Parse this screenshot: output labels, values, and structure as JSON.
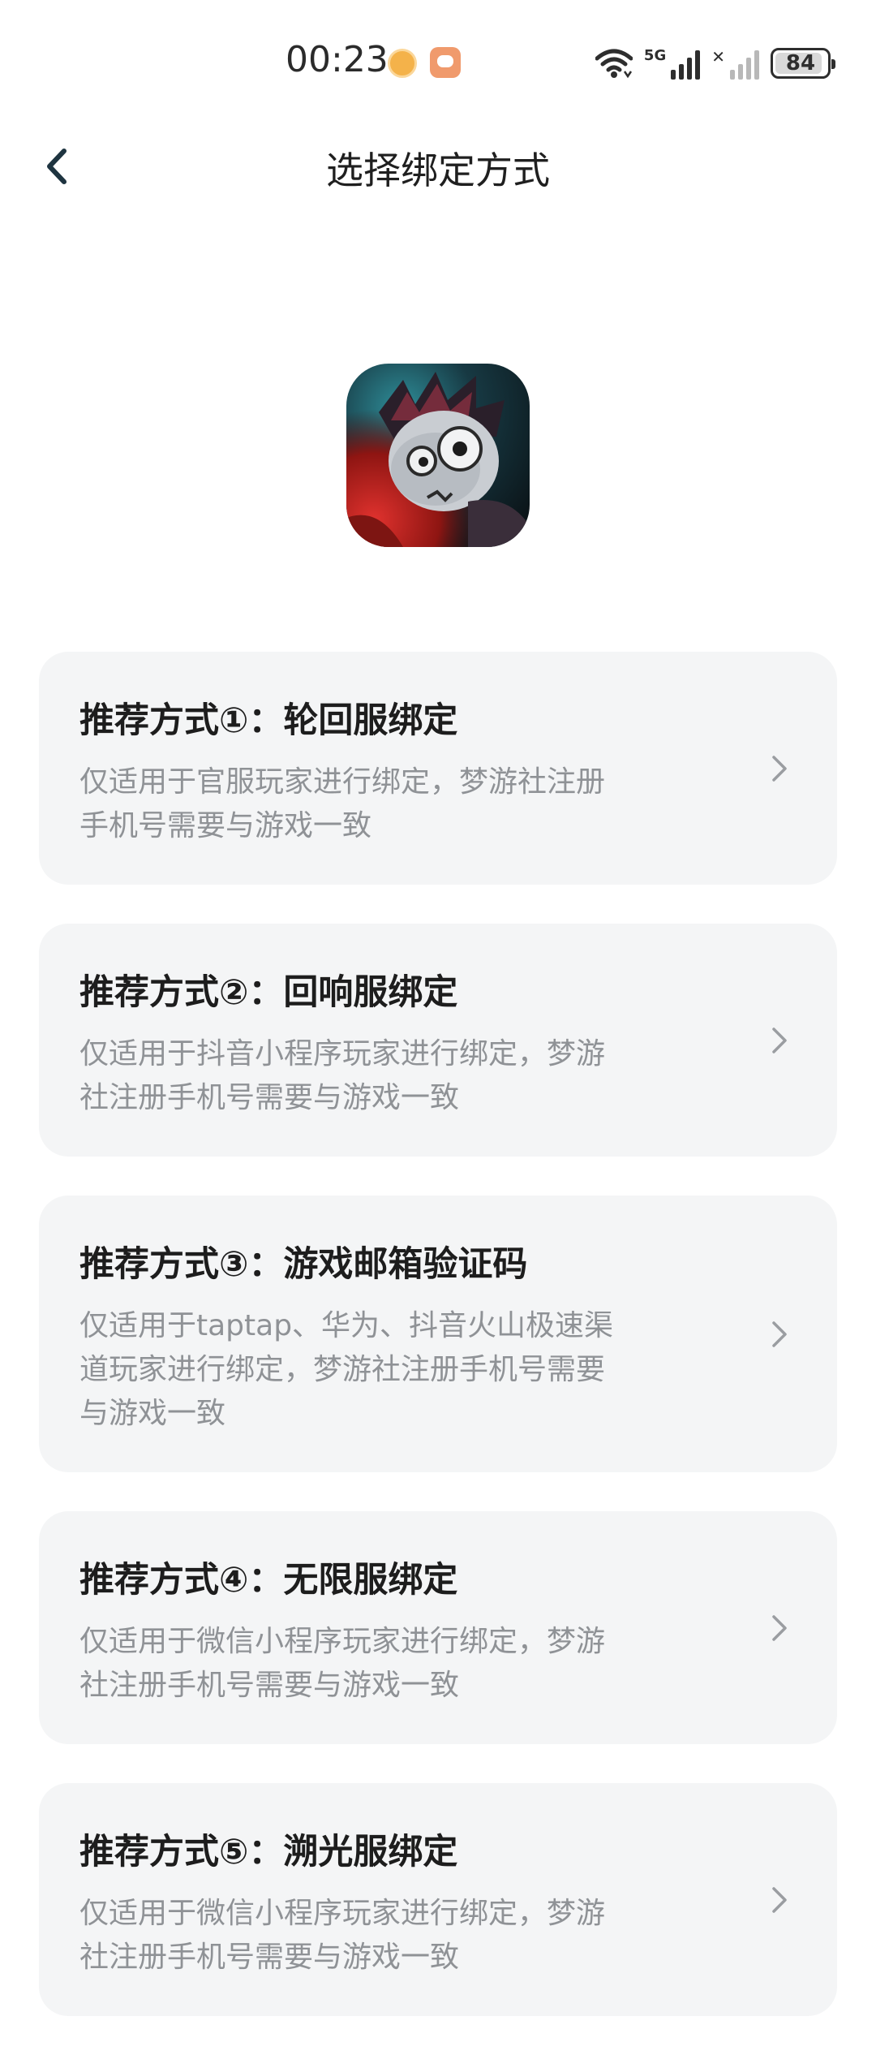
{
  "status_bar": {
    "time": "00:23",
    "network": "5G",
    "battery_level": "84",
    "battery_fraction": 0.84
  },
  "header": {
    "title": "选择绑定方式"
  },
  "options": [
    {
      "title": "推荐方式①：轮回服绑定",
      "desc_lines": [
        "仅适用于官服玩家进行绑定，梦游社注册",
        "手机号需要与游戏一致"
      ]
    },
    {
      "title": "推荐方式②：回响服绑定",
      "desc_lines": [
        "仅适用于抖音小程序玩家进行绑定，梦游",
        "社注册手机号需要与游戏一致"
      ]
    },
    {
      "title": "推荐方式③：游戏邮箱验证码",
      "desc_lines": [
        "仅适用于taptap、华为、抖音火山极速渠",
        "道玩家进行绑定，梦游社注册手机号需要",
        "与游戏一致"
      ]
    },
    {
      "title": "推荐方式④：无限服绑定",
      "desc_lines": [
        "仅适用于微信小程序玩家进行绑定，梦游",
        "社注册手机号需要与游戏一致"
      ]
    },
    {
      "title": "推荐方式⑤：溯光服绑定",
      "desc_lines": [
        "仅适用于微信小程序玩家进行绑定，梦游",
        "社注册手机号需要与游戏一致"
      ]
    }
  ],
  "colors": {
    "card_background": "#f4f5f6",
    "title_text": "#1d1d1d",
    "desc_text": "#8f9296",
    "back_icon": "#1e3440"
  },
  "icons": {
    "back": "chevron-left-icon",
    "row": "chevron-right-icon",
    "app": "game-app-icon"
  }
}
